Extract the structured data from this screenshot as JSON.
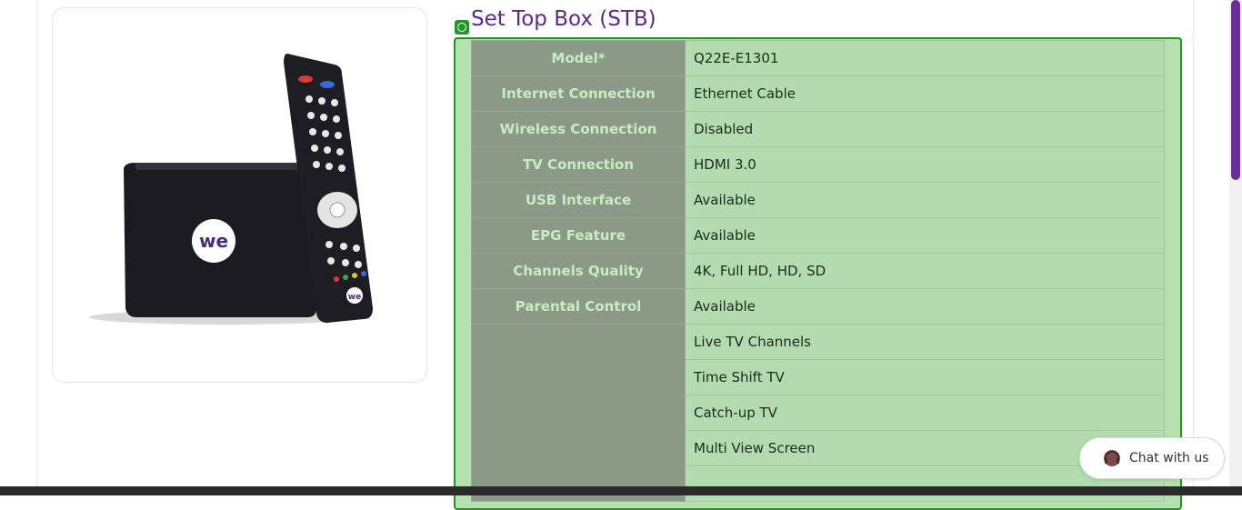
{
  "product": {
    "title": "Set Top Box (STB)",
    "brand_logo_text": "we",
    "image_alt": "WE set top box with remote control"
  },
  "specs": [
    {
      "label": "Model*",
      "value": "Q22E-E1301"
    },
    {
      "label": "Internet Connection",
      "value": "Ethernet Cable"
    },
    {
      "label": "Wireless Connection",
      "value": "Disabled"
    },
    {
      "label": "TV Connection",
      "value": "HDMI 3.0"
    },
    {
      "label": "USB Interface",
      "value": "Available"
    },
    {
      "label": "EPG Feature",
      "value": "Available"
    },
    {
      "label": "Channels Quality",
      "value": "4K, Full HD, HD, SD"
    },
    {
      "label": "Parental Control",
      "value": "Available"
    }
  ],
  "features": [
    "Live TV Channels",
    "Time Shift TV",
    "Catch-up TV",
    "Multi View Screen",
    ""
  ],
  "chat": {
    "label": "Chat with us",
    "icon": "headset-chat-icon"
  },
  "colors": {
    "title": "#5b2a86",
    "overlay": "#1a9a1a",
    "scrollbar_thumb": "#6b2d9e"
  }
}
